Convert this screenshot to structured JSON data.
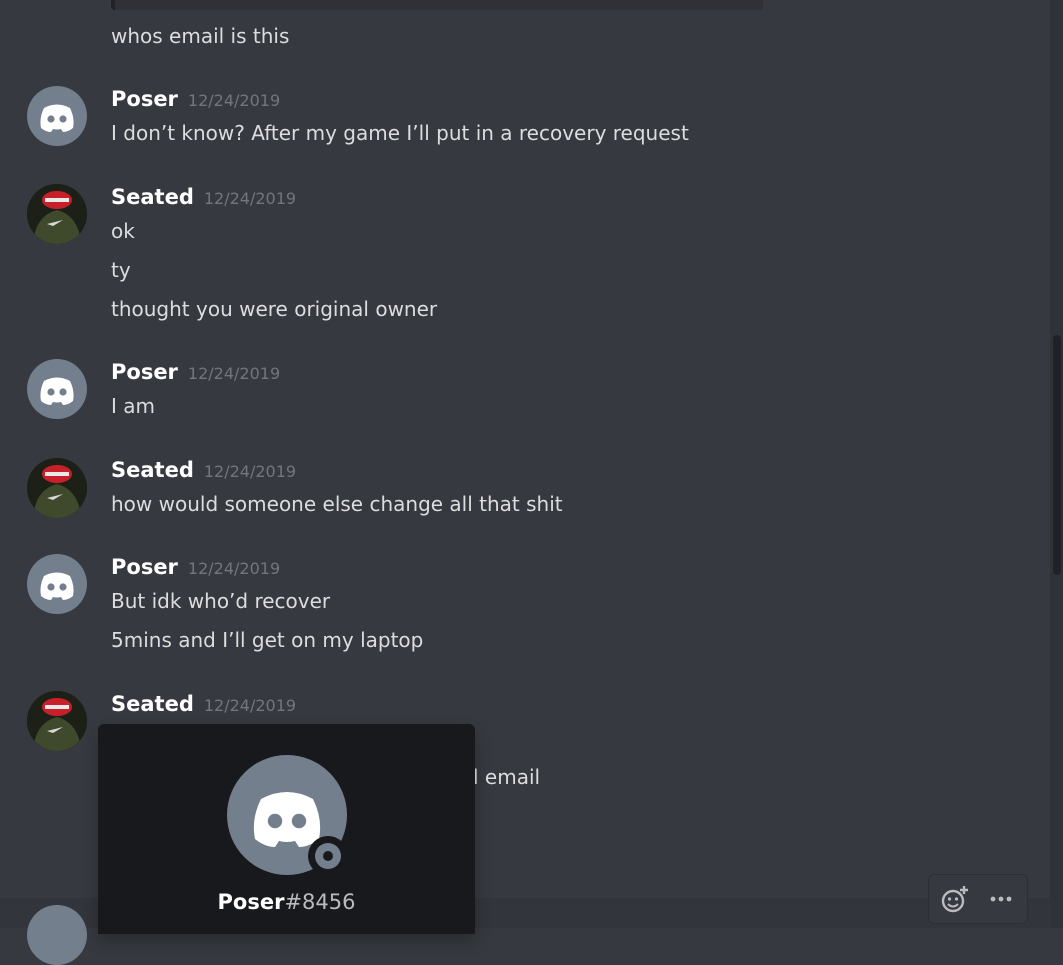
{
  "messages": [
    {
      "author": "",
      "timestamp": "",
      "lines": [
        "whos email is this"
      ]
    },
    {
      "author": "Poser",
      "timestamp": "12/24/2019",
      "lines": [
        "I don’t know? After my game I’ll put in a recovery request"
      ]
    },
    {
      "author": "Seated",
      "timestamp": "12/24/2019",
      "lines": [
        "ok",
        "ty",
        "thought you were original owner"
      ]
    },
    {
      "author": "Poser",
      "timestamp": "12/24/2019",
      "lines": [
        "I am"
      ]
    },
    {
      "author": "Seated",
      "timestamp": "12/24/2019",
      "lines": [
        "how would someone else change all that shit"
      ]
    },
    {
      "author": "Poser",
      "timestamp": "12/24/2019",
      "lines": [
        "But idk who’d recover",
        "5mins and I’ll get on my laptop"
      ]
    },
    {
      "author": "Seated",
      "timestamp": "12/24/2019",
      "lines": [
        "l email"
      ]
    }
  ],
  "popout": {
    "username": "Poser",
    "discriminator": "#8456",
    "status": "offline"
  },
  "toolbar": {
    "icons": [
      "add-reaction-icon",
      "more-options-icon"
    ]
  },
  "colors": {
    "background": "#36393f",
    "popout": "#18191c",
    "avatar_default": "#747f8d",
    "timestamp": "#72767d"
  }
}
